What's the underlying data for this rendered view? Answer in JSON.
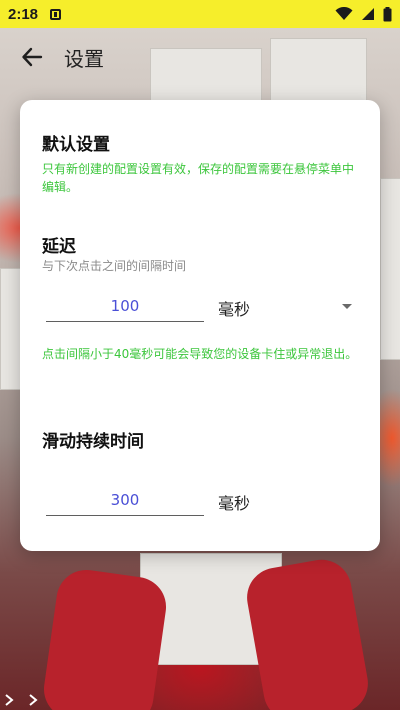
{
  "status_bar": {
    "time": "2:18",
    "icons": [
      "notification-icon",
      "wifi-icon",
      "signal-icon",
      "battery-icon"
    ]
  },
  "app_bar": {
    "title": "设置",
    "back_icon": "arrow-left-icon"
  },
  "dialog": {
    "default_settings": {
      "heading": "默认设置",
      "note": "只有新创建的配置设置有效，保存的配置需要在悬停菜单中编辑。"
    },
    "delay": {
      "heading": "延迟",
      "subtitle": "与下次点击之间的间隔时间",
      "value": "100",
      "unit": "毫秒",
      "warning": "点击间隔小于40毫秒可能会导致您的设备卡住或异常退出。"
    },
    "swipe_duration": {
      "heading": "滑动持续时间",
      "value": "300",
      "unit": "毫秒"
    }
  },
  "colors": {
    "status_bar_bg": "#f6ee2b",
    "note_green": "#3cc63c",
    "input_text": "#4a4fd6"
  }
}
